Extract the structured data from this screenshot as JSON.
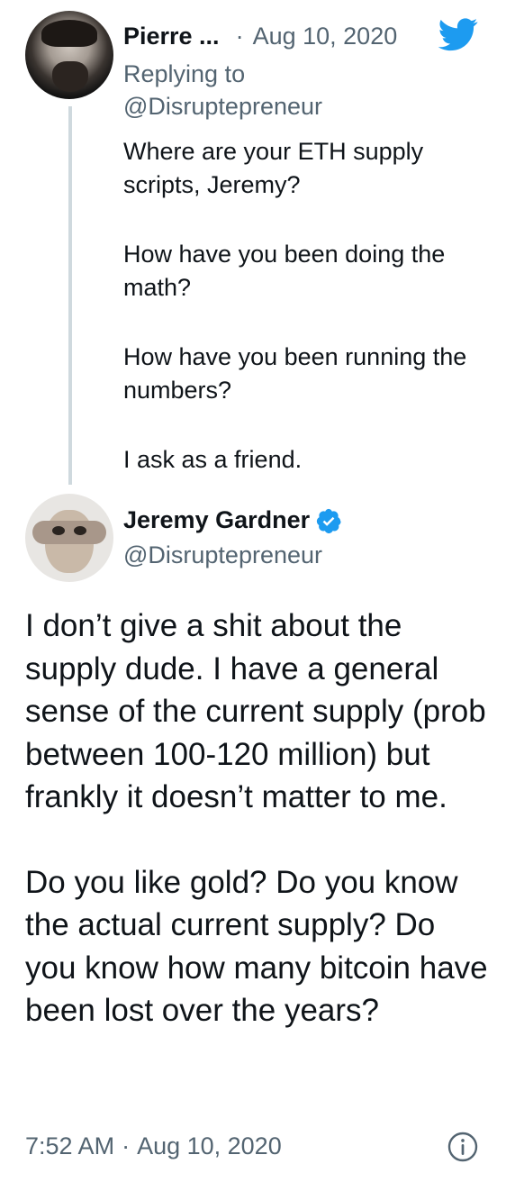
{
  "reply_tweet": {
    "author_name": "Pierre ...",
    "separator": "·",
    "date": "Aug 10, 2020",
    "replying_to_label": "Replying to",
    "replying_to_handle": "@Disruptepreneur",
    "paragraphs": [
      "Where are your ETH supply scripts, Jeremy?",
      "How have you been doing the math?",
      "How have you been running the numbers?",
      "I ask as a friend."
    ]
  },
  "main_tweet": {
    "author_name": "Jeremy Gardner",
    "handle": "@Disruptepreneur",
    "paragraphs": [
      "I don’t give a shit about the supply dude. I have a general sense of the current supply (prob between 100-120 million) but frankly it doesn’t matter to me.",
      "Do you like gold? Do you know the actual current supply? Do you know how many bitcoin have been lost over the years?"
    ],
    "time": "7:52 AM",
    "separator": "·",
    "date": "Aug 10, 2020"
  },
  "icons": {
    "twitter": "twitter-bird-icon",
    "verified": "verified-badge-icon",
    "info": "info-icon"
  },
  "colors": {
    "twitter_blue": "#1d9bf0",
    "secondary_text": "#536471",
    "thread_line": "#cfd9de"
  }
}
